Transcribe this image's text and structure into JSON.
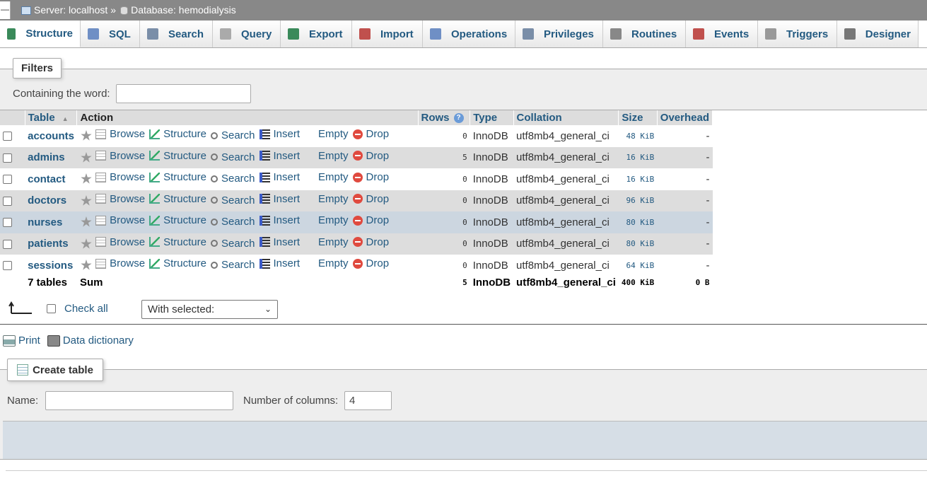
{
  "topbar": {
    "collapse": "—",
    "server": "Server: localhost",
    "sep": "»",
    "database": "Database: hemodialysis"
  },
  "tabs": [
    {
      "label": "Structure",
      "color": "#3a8a5a"
    },
    {
      "label": "SQL",
      "color": "#6f8fc5"
    },
    {
      "label": "Search",
      "color": "#7a8ea8"
    },
    {
      "label": "Query",
      "color": "#aaaaaa"
    },
    {
      "label": "Export",
      "color": "#3a8a5a"
    },
    {
      "label": "Import",
      "color": "#c0504d"
    },
    {
      "label": "Operations",
      "color": "#6f8fc5"
    },
    {
      "label": "Privileges",
      "color": "#7a8ea8"
    },
    {
      "label": "Routines",
      "color": "#888888"
    },
    {
      "label": "Events",
      "color": "#c0504d"
    },
    {
      "label": "Triggers",
      "color": "#999999"
    },
    {
      "label": "Designer",
      "color": "#777777"
    }
  ],
  "filters": {
    "legend": "Filters",
    "label": "Containing the word:",
    "value": ""
  },
  "table": {
    "headers": {
      "table": "Table",
      "sort": "▲",
      "action": "Action",
      "rows": "Rows",
      "rows_help": "?",
      "type": "Type",
      "collation": "Collation",
      "size": "Size",
      "overhead": "Overhead"
    },
    "actions": [
      "Browse",
      "Structure",
      "Search",
      "Insert",
      "Empty",
      "Drop"
    ],
    "rows": [
      {
        "name": "accounts",
        "rows": "0",
        "type": "InnoDB",
        "collation": "utf8mb4_general_ci",
        "size": "48 KiB",
        "overhead": "-"
      },
      {
        "name": "admins",
        "rows": "5",
        "type": "InnoDB",
        "collation": "utf8mb4_general_ci",
        "size": "16 KiB",
        "overhead": "-"
      },
      {
        "name": "contact",
        "rows": "0",
        "type": "InnoDB",
        "collation": "utf8mb4_general_ci",
        "size": "16 KiB",
        "overhead": "-"
      },
      {
        "name": "doctors",
        "rows": "0",
        "type": "InnoDB",
        "collation": "utf8mb4_general_ci",
        "size": "96 KiB",
        "overhead": "-"
      },
      {
        "name": "nurses",
        "rows": "0",
        "type": "InnoDB",
        "collation": "utf8mb4_general_ci",
        "size": "80 KiB",
        "overhead": "-"
      },
      {
        "name": "patients",
        "rows": "0",
        "type": "InnoDB",
        "collation": "utf8mb4_general_ci",
        "size": "80 KiB",
        "overhead": "-"
      },
      {
        "name": "sessions",
        "rows": "0",
        "type": "InnoDB",
        "collation": "utf8mb4_general_ci",
        "size": "64 KiB",
        "overhead": "-"
      }
    ],
    "summary": {
      "tables": "7 tables",
      "label": "Sum",
      "rows": "5",
      "type": "InnoDB",
      "collation": "utf8mb4_general_ci",
      "size": "400 KiB",
      "overhead": "0 B"
    }
  },
  "bulk": {
    "check_all": "Check all",
    "with_selected": "With selected:"
  },
  "links": {
    "print": "Print",
    "data_dictionary": "Data dictionary"
  },
  "create": {
    "legend": "Create table",
    "name_label": "Name:",
    "name_value": "",
    "columns_label": "Number of columns:",
    "columns_value": "4"
  }
}
